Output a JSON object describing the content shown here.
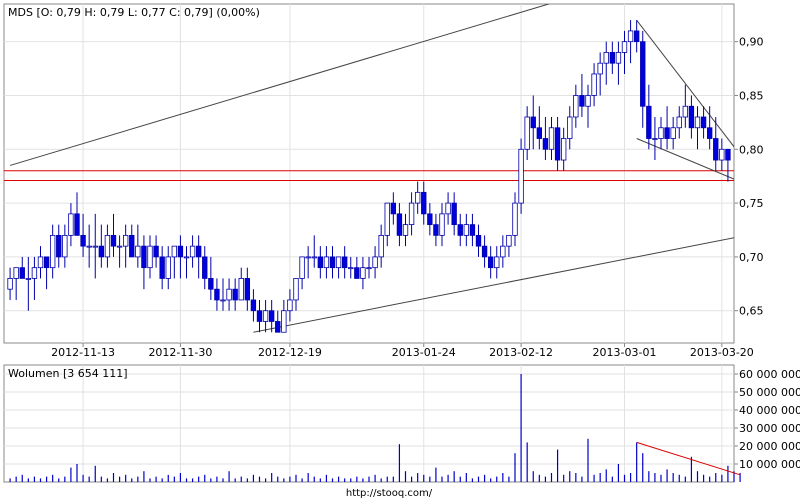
{
  "chart_data": [
    {
      "type": "candlestick",
      "title": "MDS [O: 0,79  H: 0,79  L: 0,77  C: 0,79]  (0,00%)",
      "x_tick_labels": [
        "2012-11-13",
        "2012-11-30",
        "2012-12-19",
        "2013-01-24",
        "2013-02-12",
        "2013-03-01",
        "2013-03-20"
      ],
      "y_tick_labels": [
        "0,90",
        "0,85",
        "0,80",
        "0,75",
        "0,70",
        "0,65"
      ],
      "ylim": [
        0.62,
        0.935
      ],
      "grid": true,
      "colors": {
        "rising": "#ffffff",
        "falling": "#0000dd",
        "outline": "#0000aa",
        "horizontal_lines": "#dd0000",
        "trendlines": "#444444"
      },
      "horizontal_lines": [
        0.771,
        0.78
      ],
      "candles": [
        [
          0.67,
          0.69,
          0.66,
          0.68
        ],
        [
          0.68,
          0.69,
          0.66,
          0.69
        ],
        [
          0.69,
          0.7,
          0.68,
          0.68
        ],
        [
          0.68,
          0.7,
          0.65,
          0.68
        ],
        [
          0.68,
          0.7,
          0.66,
          0.69
        ],
        [
          0.69,
          0.71,
          0.68,
          0.7
        ],
        [
          0.7,
          0.7,
          0.67,
          0.69
        ],
        [
          0.69,
          0.73,
          0.68,
          0.72
        ],
        [
          0.72,
          0.73,
          0.69,
          0.7
        ],
        [
          0.7,
          0.73,
          0.69,
          0.72
        ],
        [
          0.72,
          0.75,
          0.71,
          0.74
        ],
        [
          0.74,
          0.76,
          0.72,
          0.72
        ],
        [
          0.72,
          0.74,
          0.7,
          0.71
        ],
        [
          0.71,
          0.73,
          0.69,
          0.71
        ],
        [
          0.71,
          0.74,
          0.68,
          0.71
        ],
        [
          0.71,
          0.73,
          0.69,
          0.7
        ],
        [
          0.7,
          0.73,
          0.69,
          0.72
        ],
        [
          0.72,
          0.74,
          0.7,
          0.71
        ],
        [
          0.71,
          0.72,
          0.69,
          0.71
        ],
        [
          0.71,
          0.73,
          0.69,
          0.72
        ],
        [
          0.72,
          0.73,
          0.7,
          0.7
        ],
        [
          0.7,
          0.73,
          0.69,
          0.71
        ],
        [
          0.71,
          0.72,
          0.67,
          0.69
        ],
        [
          0.69,
          0.72,
          0.68,
          0.71
        ],
        [
          0.71,
          0.72,
          0.69,
          0.7
        ],
        [
          0.7,
          0.71,
          0.67,
          0.68
        ],
        [
          0.68,
          0.71,
          0.67,
          0.7
        ],
        [
          0.7,
          0.71,
          0.68,
          0.71
        ],
        [
          0.71,
          0.72,
          0.68,
          0.7
        ],
        [
          0.7,
          0.71,
          0.68,
          0.7
        ],
        [
          0.7,
          0.72,
          0.69,
          0.71
        ],
        [
          0.71,
          0.72,
          0.68,
          0.7
        ],
        [
          0.7,
          0.71,
          0.67,
          0.68
        ],
        [
          0.68,
          0.7,
          0.66,
          0.67
        ],
        [
          0.67,
          0.68,
          0.65,
          0.66
        ],
        [
          0.66,
          0.68,
          0.65,
          0.66
        ],
        [
          0.66,
          0.68,
          0.65,
          0.67
        ],
        [
          0.67,
          0.68,
          0.65,
          0.66
        ],
        [
          0.66,
          0.69,
          0.66,
          0.68
        ],
        [
          0.68,
          0.69,
          0.65,
          0.66
        ],
        [
          0.66,
          0.67,
          0.64,
          0.65
        ],
        [
          0.65,
          0.66,
          0.63,
          0.64
        ],
        [
          0.64,
          0.66,
          0.63,
          0.65
        ],
        [
          0.65,
          0.66,
          0.63,
          0.64
        ],
        [
          0.64,
          0.65,
          0.63,
          0.63
        ],
        [
          0.63,
          0.66,
          0.63,
          0.65
        ],
        [
          0.65,
          0.67,
          0.64,
          0.66
        ],
        [
          0.66,
          0.68,
          0.65,
          0.68
        ],
        [
          0.68,
          0.7,
          0.67,
          0.7
        ],
        [
          0.7,
          0.71,
          0.68,
          0.7
        ],
        [
          0.7,
          0.72,
          0.69,
          0.7
        ],
        [
          0.7,
          0.71,
          0.68,
          0.69
        ],
        [
          0.69,
          0.71,
          0.68,
          0.7
        ],
        [
          0.7,
          0.71,
          0.68,
          0.69
        ],
        [
          0.69,
          0.7,
          0.68,
          0.7
        ],
        [
          0.7,
          0.71,
          0.68,
          0.69
        ],
        [
          0.69,
          0.7,
          0.68,
          0.69
        ],
        [
          0.69,
          0.7,
          0.68,
          0.68
        ],
        [
          0.68,
          0.7,
          0.67,
          0.69
        ],
        [
          0.69,
          0.7,
          0.68,
          0.69
        ],
        [
          0.69,
          0.71,
          0.68,
          0.7
        ],
        [
          0.7,
          0.73,
          0.69,
          0.72
        ],
        [
          0.72,
          0.75,
          0.71,
          0.75
        ],
        [
          0.75,
          0.76,
          0.73,
          0.74
        ],
        [
          0.74,
          0.75,
          0.71,
          0.72
        ],
        [
          0.72,
          0.74,
          0.71,
          0.73
        ],
        [
          0.73,
          0.76,
          0.72,
          0.75
        ],
        [
          0.75,
          0.77,
          0.74,
          0.76
        ],
        [
          0.76,
          0.77,
          0.73,
          0.74
        ],
        [
          0.74,
          0.75,
          0.72,
          0.73
        ],
        [
          0.73,
          0.74,
          0.71,
          0.72
        ],
        [
          0.72,
          0.75,
          0.71,
          0.74
        ],
        [
          0.74,
          0.76,
          0.73,
          0.75
        ],
        [
          0.75,
          0.76,
          0.72,
          0.73
        ],
        [
          0.73,
          0.74,
          0.71,
          0.72
        ],
        [
          0.72,
          0.74,
          0.71,
          0.73
        ],
        [
          0.73,
          0.74,
          0.71,
          0.72
        ],
        [
          0.72,
          0.73,
          0.7,
          0.71
        ],
        [
          0.71,
          0.72,
          0.69,
          0.7
        ],
        [
          0.7,
          0.71,
          0.68,
          0.69
        ],
        [
          0.69,
          0.71,
          0.68,
          0.7
        ],
        [
          0.7,
          0.72,
          0.69,
          0.71
        ],
        [
          0.71,
          0.72,
          0.7,
          0.72
        ],
        [
          0.72,
          0.76,
          0.71,
          0.75
        ],
        [
          0.75,
          0.81,
          0.74,
          0.8
        ],
        [
          0.8,
          0.84,
          0.79,
          0.83
        ],
        [
          0.83,
          0.85,
          0.8,
          0.82
        ],
        [
          0.82,
          0.84,
          0.8,
          0.81
        ],
        [
          0.81,
          0.83,
          0.79,
          0.8
        ],
        [
          0.8,
          0.83,
          0.79,
          0.82
        ],
        [
          0.82,
          0.83,
          0.78,
          0.79
        ],
        [
          0.79,
          0.82,
          0.78,
          0.81
        ],
        [
          0.81,
          0.84,
          0.8,
          0.83
        ],
        [
          0.83,
          0.86,
          0.82,
          0.85
        ],
        [
          0.85,
          0.87,
          0.83,
          0.84
        ],
        [
          0.84,
          0.86,
          0.82,
          0.85
        ],
        [
          0.85,
          0.88,
          0.84,
          0.87
        ],
        [
          0.87,
          0.89,
          0.85,
          0.88
        ],
        [
          0.88,
          0.9,
          0.86,
          0.89
        ],
        [
          0.89,
          0.9,
          0.87,
          0.88
        ],
        [
          0.88,
          0.9,
          0.86,
          0.89
        ],
        [
          0.89,
          0.91,
          0.87,
          0.9
        ],
        [
          0.9,
          0.92,
          0.88,
          0.91
        ],
        [
          0.91,
          0.92,
          0.89,
          0.9
        ],
        [
          0.9,
          0.91,
          0.82,
          0.84
        ],
        [
          0.84,
          0.86,
          0.8,
          0.81
        ],
        [
          0.81,
          0.83,
          0.79,
          0.81
        ],
        [
          0.81,
          0.83,
          0.8,
          0.82
        ],
        [
          0.82,
          0.84,
          0.8,
          0.81
        ],
        [
          0.81,
          0.83,
          0.8,
          0.82
        ],
        [
          0.82,
          0.84,
          0.81,
          0.83
        ],
        [
          0.83,
          0.86,
          0.82,
          0.84
        ],
        [
          0.84,
          0.85,
          0.81,
          0.82
        ],
        [
          0.82,
          0.84,
          0.8,
          0.83
        ],
        [
          0.83,
          0.84,
          0.81,
          0.82
        ],
        [
          0.82,
          0.84,
          0.8,
          0.81
        ],
        [
          0.81,
          0.83,
          0.78,
          0.79
        ],
        [
          0.79,
          0.81,
          0.78,
          0.8
        ],
        [
          0.8,
          0.8,
          0.77,
          0.79
        ]
      ],
      "trendlines": [
        [
          [
            0,
            0.785
          ],
          [
            121,
            0.99
          ]
        ],
        [
          [
            40,
            0.63
          ],
          [
            121,
            0.72
          ]
        ],
        [
          [
            103,
            0.92
          ],
          [
            120,
            0.795
          ]
        ],
        [
          [
            103,
            0.81
          ],
          [
            120,
            0.77
          ]
        ]
      ]
    },
    {
      "type": "bar",
      "title": "Wolumen [3 654 111]",
      "y_tick_labels": [
        "60 000 000",
        "50 000 000",
        "40 000 000",
        "30 000 000",
        "20 000 000",
        "10 000 000"
      ],
      "ylim": [
        0,
        65000000
      ],
      "grid": true,
      "colors": {
        "bars": "#0000cc",
        "trendline": "#dd0000"
      },
      "trendline": [
        [
          103,
          22000000
        ],
        [
          120,
          4000000
        ]
      ],
      "values": [
        2000000,
        3000000,
        4000000,
        2000000,
        3000000,
        2000000,
        3000000,
        4000000,
        2000000,
        3000000,
        8000000,
        10000000,
        4000000,
        3000000,
        9000000,
        3000000,
        2000000,
        5000000,
        3000000,
        4000000,
        2000000,
        3000000,
        6000000,
        2000000,
        3000000,
        2000000,
        4000000,
        3000000,
        5000000,
        2000000,
        2000000,
        3000000,
        4000000,
        2000000,
        3000000,
        2000000,
        6000000,
        2000000,
        3000000,
        2000000,
        4000000,
        3000000,
        2000000,
        5000000,
        3000000,
        2000000,
        3000000,
        4000000,
        2000000,
        5000000,
        3000000,
        2000000,
        4000000,
        2000000,
        3000000,
        2000000,
        2000000,
        3000000,
        2000000,
        3000000,
        4000000,
        2000000,
        3000000,
        3000000,
        21000000,
        6000000,
        3000000,
        5000000,
        4000000,
        3000000,
        8000000,
        3000000,
        4000000,
        6000000,
        3000000,
        5000000,
        2000000,
        3000000,
        4000000,
        2000000,
        3000000,
        5000000,
        3000000,
        16000000,
        60000000,
        22000000,
        6000000,
        4000000,
        3000000,
        5000000,
        18000000,
        4000000,
        6000000,
        5000000,
        3000000,
        24000000,
        4000000,
        5000000,
        7000000,
        3000000,
        10000000,
        4000000,
        5000000,
        22000000,
        16000000,
        6000000,
        5000000,
        4000000,
        7000000,
        5000000,
        4000000,
        3000000,
        14000000,
        6000000,
        4000000,
        3000000,
        5000000,
        4000000,
        9000000,
        6000000,
        5000000
      ]
    }
  ],
  "footer": {
    "url": "http://stooq.com/"
  }
}
